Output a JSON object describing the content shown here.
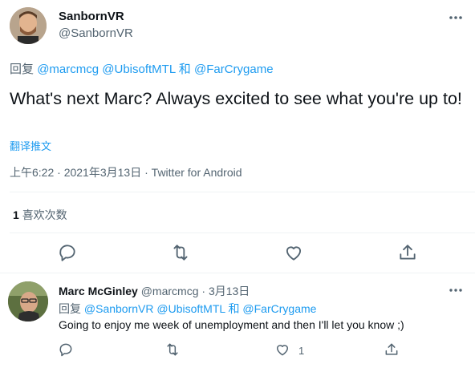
{
  "main_tweet": {
    "author_name": "SanbornVR",
    "author_handle": "@SanbornVR",
    "reply_prefix": "回复",
    "reply_to_1": "@marcmcg",
    "reply_to_2": "@UbisoftMTL",
    "reply_and": "和",
    "reply_to_3": "@FarCrygame",
    "text": "What's next Marc? Always excited to see what you're up to!",
    "translate_label": "翻译推文",
    "time": "上午6:22",
    "date": "2021年3月13日",
    "separator": "·",
    "source": "Twitter for Android",
    "likes_count": "1",
    "likes_label": "喜欢次数",
    "actions": [
      "reply-icon",
      "retweet-icon",
      "like-icon",
      "share-icon"
    ]
  },
  "reply_tweet": {
    "author_name": "Marc McGinley",
    "author_handle": "@marcmcg",
    "separator": "·",
    "date": "3月13日",
    "reply_prefix": "回复",
    "reply_to_1": "@SanbornVR",
    "reply_to_2": "@UbisoftMTL",
    "reply_and": "和",
    "reply_to_3": "@FarCrygame",
    "text": "Going to enjoy me week of unemployment and then I'll let you know ;)",
    "like_count": "1"
  },
  "colors": {
    "link": "#1d9bf0",
    "secondary_text": "#536471",
    "primary_text": "#0f1419",
    "divider": "#eff3f4"
  }
}
